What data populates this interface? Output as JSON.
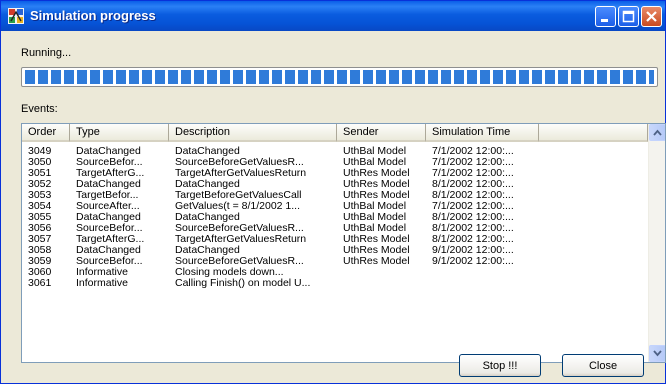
{
  "window": {
    "title": "Simulation progress",
    "icon": "app-icon"
  },
  "status": {
    "text": "Running..."
  },
  "progress": {
    "percent": 100,
    "accent": "#2f7bd9"
  },
  "events": {
    "label": "Events:",
    "columns": [
      "Order",
      "Type",
      "Description",
      "Sender",
      "Simulation Time",
      ""
    ],
    "rows": [
      [
        "3049",
        "DataChanged",
        "DataChanged",
        "UthBal Model",
        "7/1/2002 12:00:..."
      ],
      [
        "3050",
        "SourceBefor...",
        "SourceBeforeGetValuesR...",
        "UthBal Model",
        "7/1/2002 12:00:..."
      ],
      [
        "3051",
        "TargetAfterG...",
        "TargetAfterGetValuesReturn",
        "UthRes Model",
        "7/1/2002 12:00:..."
      ],
      [
        "3052",
        "DataChanged",
        "DataChanged",
        "UthRes Model",
        "8/1/2002 12:00:..."
      ],
      [
        "3053",
        "TargetBefor...",
        "TargetBeforeGetValuesCall",
        "UthRes Model",
        "8/1/2002 12:00:..."
      ],
      [
        "3054",
        "SourceAfter...",
        "GetValues(t = 8/1/2002 1...",
        "UthBal Model",
        "7/1/2002 12:00:..."
      ],
      [
        "3055",
        "DataChanged",
        "DataChanged",
        "UthBal Model",
        "8/1/2002 12:00:..."
      ],
      [
        "3056",
        "SourceBefor...",
        "SourceBeforeGetValuesR...",
        "UthBal Model",
        "8/1/2002 12:00:..."
      ],
      [
        "3057",
        "TargetAfterG...",
        "TargetAfterGetValuesReturn",
        "UthRes Model",
        "8/1/2002 12:00:..."
      ],
      [
        "3058",
        "DataChanged",
        "DataChanged",
        "UthRes Model",
        "9/1/2002 12:00:..."
      ],
      [
        "3059",
        "SourceBefor...",
        "SourceBeforeGetValuesR...",
        "UthRes Model",
        "9/1/2002 12:00:..."
      ],
      [
        "3060",
        "Informative",
        "Closing models down...",
        "",
        ""
      ],
      [
        "3061",
        "Informative",
        "Calling Finish() on model U...",
        "",
        ""
      ]
    ]
  },
  "buttons": {
    "stop": "Stop !!!",
    "close": "Close"
  }
}
